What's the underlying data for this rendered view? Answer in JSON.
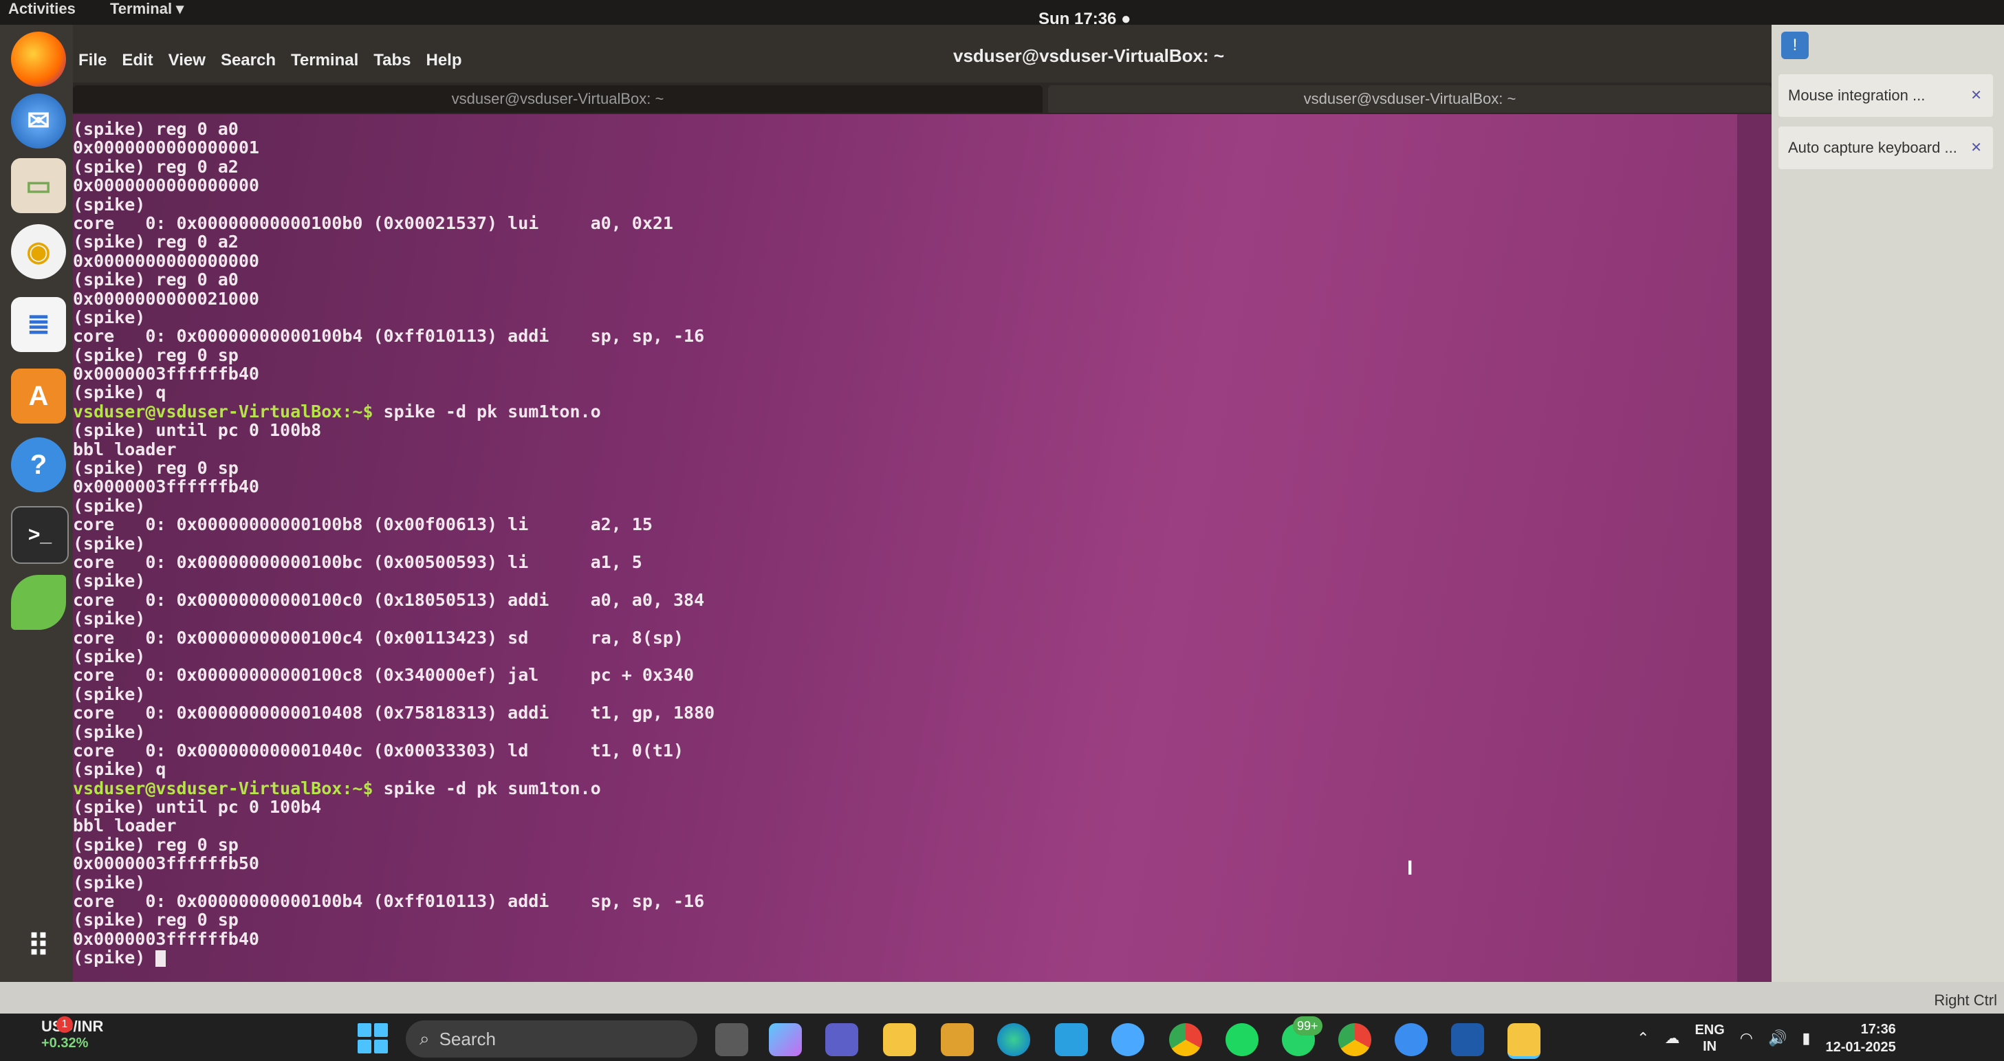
{
  "topbar": {
    "activities": "Activities",
    "app_menu": "Terminal ▾",
    "clock": "Sun 17:36 ●"
  },
  "window": {
    "title": "vsduser@vsduser-VirtualBox: ~",
    "menu": [
      "File",
      "Edit",
      "View",
      "Search",
      "Terminal",
      "Tabs",
      "Help"
    ],
    "tabs": [
      {
        "label": "vsduser@vsduser-VirtualBox: ~"
      },
      {
        "label": "vsduser@vsduser-VirtualBox: ~"
      }
    ]
  },
  "terminal": {
    "lines": [
      {
        "text": "(spike) reg 0 a0"
      },
      {
        "text": "0x0000000000000001"
      },
      {
        "text": "(spike) reg 0 a2"
      },
      {
        "text": "0x0000000000000000"
      },
      {
        "text": "(spike)"
      },
      {
        "text": "core   0: 0x00000000000100b0 (0x00021537) lui     a0, 0x21"
      },
      {
        "text": "(spike) reg 0 a2"
      },
      {
        "text": "0x0000000000000000"
      },
      {
        "text": "(spike) reg 0 a0"
      },
      {
        "text": "0x0000000000021000"
      },
      {
        "text": "(spike)"
      },
      {
        "text": "core   0: 0x00000000000100b4 (0xff010113) addi    sp, sp, -16"
      },
      {
        "text": "(spike) reg 0 sp"
      },
      {
        "text": "0x0000003ffffffb40"
      },
      {
        "text": "(spike) q"
      },
      {
        "prompt": "vsduser@vsduser-VirtualBox",
        "path": ":~$",
        "text": " spike -d pk sum1ton.o"
      },
      {
        "text": "(spike) until pc 0 100b8"
      },
      {
        "text": "bbl loader"
      },
      {
        "text": "(spike) reg 0 sp"
      },
      {
        "text": "0x0000003ffffffb40"
      },
      {
        "text": "(spike)"
      },
      {
        "text": "core   0: 0x00000000000100b8 (0x00f00613) li      a2, 15"
      },
      {
        "text": "(spike)"
      },
      {
        "text": "core   0: 0x00000000000100bc (0x00500593) li      a1, 5"
      },
      {
        "text": "(spike)"
      },
      {
        "text": "core   0: 0x00000000000100c0 (0x18050513) addi    a0, a0, 384"
      },
      {
        "text": "(spike)"
      },
      {
        "text": "core   0: 0x00000000000100c4 (0x00113423) sd      ra, 8(sp)"
      },
      {
        "text": "(spike)"
      },
      {
        "text": "core   0: 0x00000000000100c8 (0x340000ef) jal     pc + 0x340"
      },
      {
        "text": "(spike)"
      },
      {
        "text": "core   0: 0x0000000000010408 (0x75818313) addi    t1, gp, 1880"
      },
      {
        "text": "(spike)"
      },
      {
        "text": "core   0: 0x000000000001040c (0x00033303) ld      t1, 0(t1)"
      },
      {
        "text": "(spike) q"
      },
      {
        "prompt": "vsduser@vsduser-VirtualBox",
        "path": ":~$",
        "text": " spike -d pk sum1ton.o"
      },
      {
        "text": "(spike) until pc 0 100b4"
      },
      {
        "text": "bbl loader"
      },
      {
        "text": "(spike) reg 0 sp"
      },
      {
        "text": "0x0000003ffffffb50"
      },
      {
        "text": "(spike)"
      },
      {
        "text": "core   0: 0x00000000000100b4 (0xff010113) addi    sp, sp, -16"
      },
      {
        "text": "(spike) reg 0 sp"
      },
      {
        "text": "0x0000003ffffffb40"
      },
      {
        "text": "(spike) ",
        "cursor": true
      }
    ]
  },
  "right_panel": {
    "mouse_integration": "Mouse integration ...",
    "auto_capture": "Auto capture keyboard ..."
  },
  "vbox_status": {
    "host_key": "Right Ctrl"
  },
  "taskbar": {
    "weather_title": "USD/INR",
    "weather_change": "+0.32%",
    "weather_badge": "1",
    "search_placeholder": "Search",
    "whatsapp_badge": "99+",
    "lang_top": "ENG",
    "lang_bottom": "IN",
    "time": "17:36",
    "date": "12-01-2025"
  },
  "colors": {
    "terminal_bg": "#7d2f6b",
    "prompt_green": "#b7e44a",
    "terminal_text": "#f1e8ee"
  }
}
